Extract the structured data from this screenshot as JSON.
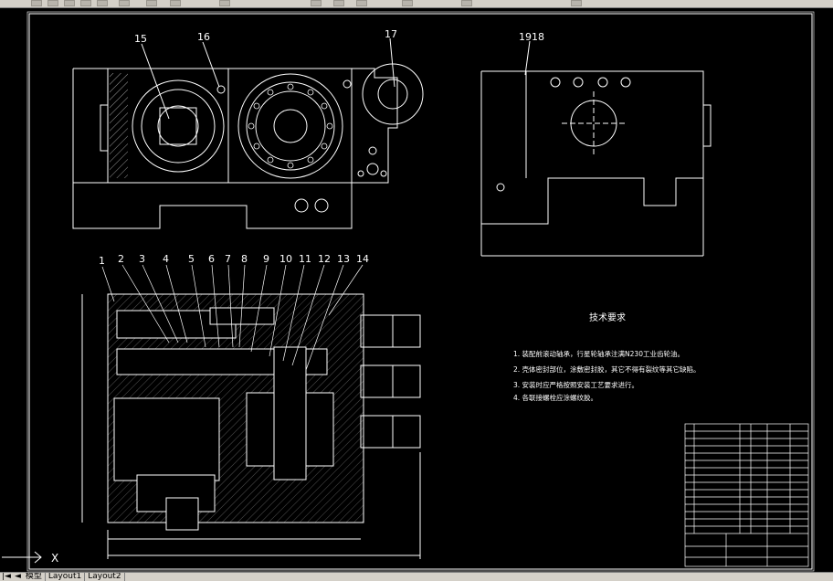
{
  "toolbar": {
    "icons": [
      "open-icon",
      "save-icon",
      "print-icon",
      "cut-icon",
      "copy-icon",
      "paste-icon",
      "undo-icon",
      "redo-icon",
      "pan-icon",
      "zoom-icon",
      "zoom-window-icon",
      "zoom-previous-icon",
      "properties-icon",
      "layer-icon",
      "text-icon"
    ]
  },
  "drawing": {
    "part_numbers_top": [
      "15",
      "16",
      "17",
      "1918"
    ],
    "part_numbers_section": [
      "1",
      "2",
      "3",
      "4",
      "5",
      "6",
      "7",
      "8",
      "9",
      "10",
      "11",
      "12",
      "13",
      "14"
    ],
    "tech_requirements": {
      "title": "技术要求",
      "items": [
        "1. 装配前滚动轴承，行星轮轴承注满N230工业齿轮油。",
        "2. 壳体密封部位，涂敷密封胶，其它不得有裂纹等其它缺陷。",
        "3. 安装时应严格按照安装工艺要求进行。",
        "4. 各联接螺栓应涂螺纹胶。"
      ]
    },
    "axis_label": "X",
    "colors": {
      "background": "#000000",
      "outline": "#ffffff",
      "dimension": "#ffffff"
    }
  },
  "tabs": {
    "nav_first": "|◄",
    "nav_prev": "◄",
    "items": [
      "模型",
      "Layout1",
      "Layout2"
    ]
  }
}
